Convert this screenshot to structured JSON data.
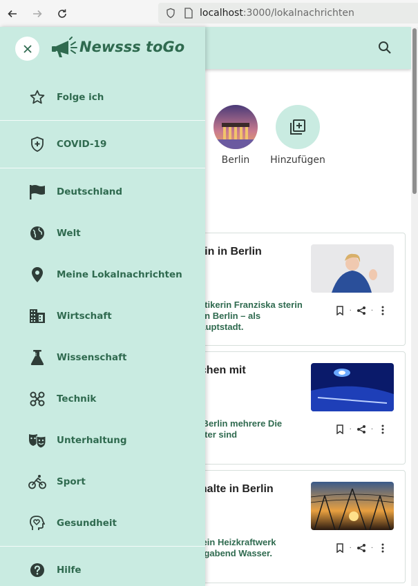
{
  "browser": {
    "url_host": "localhost",
    "url_rest": ":3000/lokalnachrichten"
  },
  "drawer": {
    "logo_text": "Newsss toGo",
    "items": [
      {
        "label": "Folge ich",
        "icon": "star-icon"
      },
      {
        "label": "COVID-19",
        "icon": "shield-plus-icon"
      },
      {
        "label": "Deutschland",
        "icon": "flag-icon"
      },
      {
        "label": "Welt",
        "icon": "globe-icon"
      },
      {
        "label": "Meine Lokalnachrichten",
        "icon": "location-pin-icon"
      },
      {
        "label": "Wirtschaft",
        "icon": "building-icon"
      },
      {
        "label": "Wissenschaft",
        "icon": "flask-icon"
      },
      {
        "label": "Technik",
        "icon": "technology-icon"
      },
      {
        "label": "Unterhaltung",
        "icon": "masks-icon"
      },
      {
        "label": "Sport",
        "icon": "bicycle-icon"
      },
      {
        "label": "Gesundheit",
        "icon": "head-heart-icon"
      },
      {
        "label": "Hilfe",
        "icon": "help-circle-icon"
      }
    ]
  },
  "page": {
    "circles": [
      {
        "label": "Berlin"
      },
      {
        "label": "Hinzufügen"
      }
    ],
    "cards": [
      {
        "title": "erin in Berlin",
        "text": "olitikerin Franziska sterin von Berlin – als Hauptstadt."
      },
      {
        "title": "schen mit",
        "text": "n Berlin mehrere Die Täter sind"
      },
      {
        "title": "shalte in Berlin",
        "text": "n ein Heizkraftwerk kagabend Wasser."
      }
    ]
  },
  "colors": {
    "accent": "#c9ebe1",
    "brand_text": "#2f6a4f"
  }
}
